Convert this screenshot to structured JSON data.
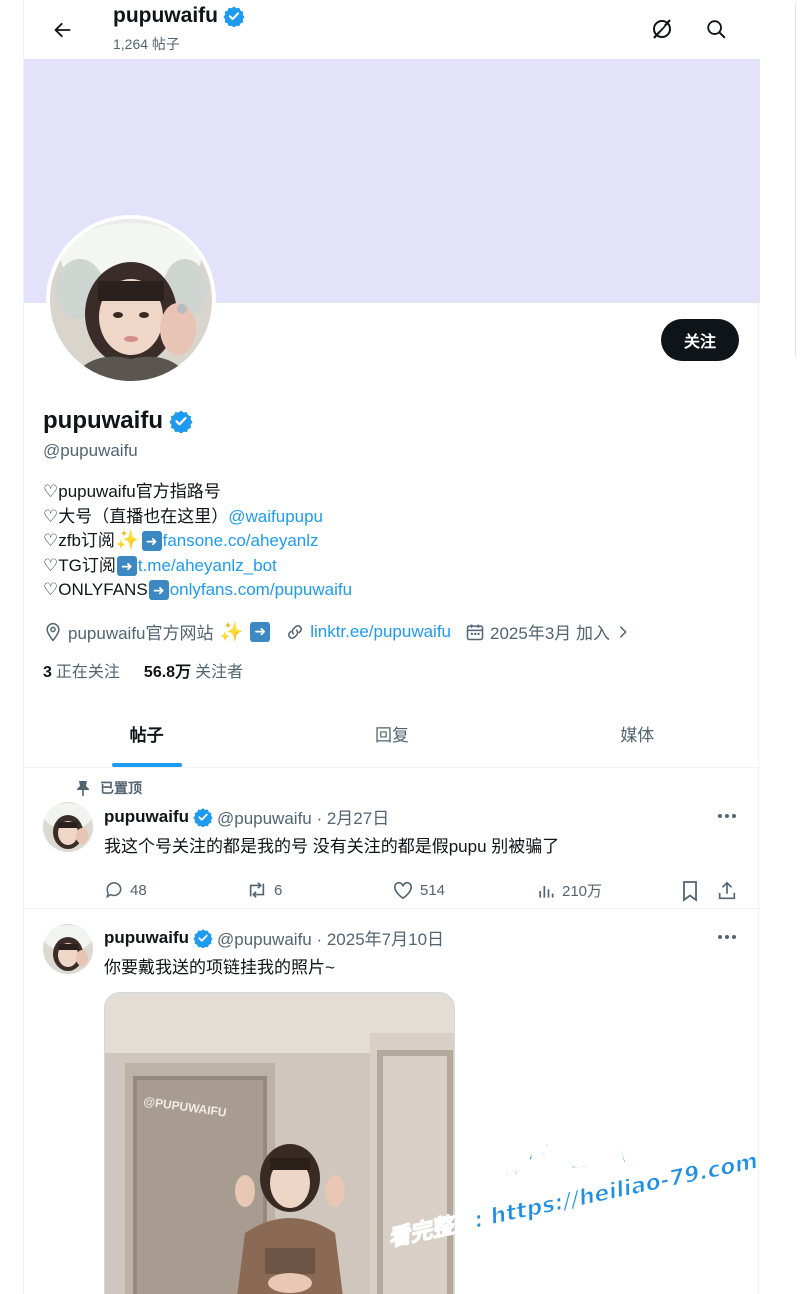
{
  "header": {
    "title": "pupuwaifu",
    "post_count": "1,264 帖子",
    "icons": [
      "back-arrow-icon",
      "grok-icon",
      "search-icon"
    ]
  },
  "profile": {
    "name": "pupuwaifu",
    "handle": "@pupuwaifu",
    "follow_label": "关注",
    "bio": {
      "l1": "♡pupuwaifu官方指路号",
      "l2_text": "♡大号（直播也在这里）",
      "l2_link": "@waifupupu",
      "l3_text": "♡zfb订阅",
      "l3_link": "fansone.co/aheyanlz",
      "l4_text": "♡TG订阅",
      "l4_link": "t.me/aheyanlz_bot",
      "l5_text": "♡ONLYFANS",
      "l5_link": "onlyfans.com/pupuwaifu"
    },
    "location": "pupuwaifu官方网站",
    "website": "linktr.ee/pupuwaifu",
    "joined": "2025年3月 加入",
    "following_count": "3",
    "following_label": "正在关注",
    "followers_count": "56.8万",
    "followers_label": "关注者",
    "colors": {
      "accent": "#1d9bf0",
      "banner": "#e4e1fa",
      "button": "#0f1419"
    }
  },
  "tabs": [
    "帖子",
    "回复",
    "媒体"
  ],
  "posts": [
    {
      "pinned_label": "已置顶",
      "name": "pupuwaifu",
      "handle_date": "@pupuwaifu · 2月27日",
      "text": "我这个号关注的都是我的号 没有关注的都是假pupu 别被骗了",
      "replies": "48",
      "reposts": "6",
      "likes": "514",
      "views": "210万"
    },
    {
      "name": "pupuwaifu",
      "handle_date": "@pupuwaifu · 2025年7月10日",
      "text": "你要戴我送的项链挂我的照片~",
      "media_watermark": "@PUPUWAIFU"
    }
  ],
  "watermark": {
    "title": "黑料吃瓜网",
    "subtitle": "看完整版: https://heiliao-79.com"
  }
}
